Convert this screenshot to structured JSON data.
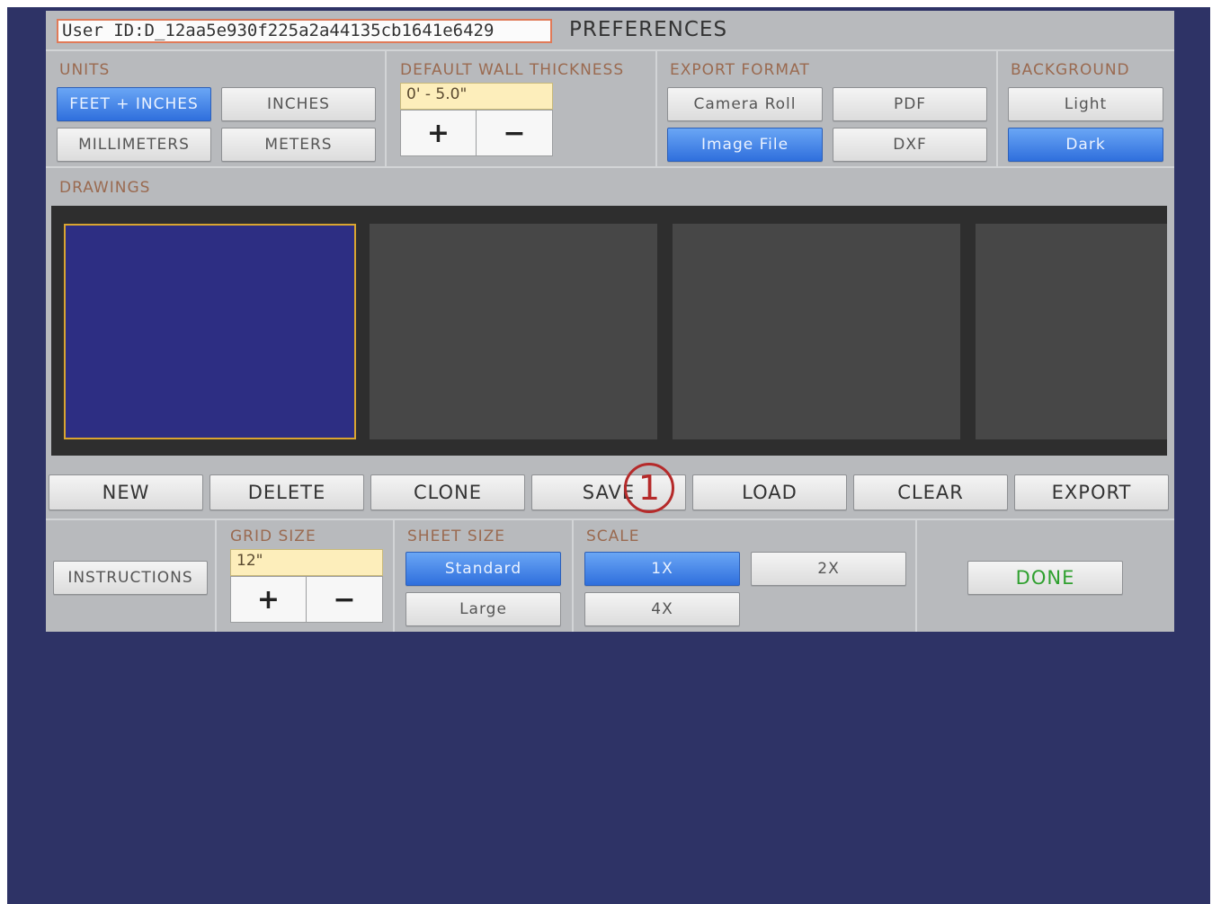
{
  "header": {
    "user_id": "User ID:D_12aa5e930f225a2a44135cb1641e6429",
    "title": "PREFERENCES"
  },
  "units": {
    "label": "UNITS",
    "options": [
      "FEET + INCHES",
      "INCHES",
      "MILLIMETERS",
      "METERS"
    ],
    "selected": "FEET + INCHES"
  },
  "wall_thickness": {
    "label": "DEFAULT WALL THICKNESS",
    "value": "0' - 5.0\"",
    "plus": "+",
    "minus": "−"
  },
  "export_format": {
    "label": "EXPORT FORMAT",
    "options": [
      "Camera Roll",
      "PDF",
      "Image File",
      "DXF"
    ],
    "selected": "Image File"
  },
  "background": {
    "label": "BACKGROUND",
    "options": [
      "Light",
      "Dark"
    ],
    "selected": "Dark"
  },
  "drawings": {
    "label": "DRAWINGS",
    "thumbnails": [
      "active",
      "empty",
      "empty",
      "empty"
    ]
  },
  "actions": [
    "NEW",
    "DELETE",
    "CLONE",
    "SAVE",
    "LOAD",
    "CLEAR",
    "EXPORT"
  ],
  "annotation": "1",
  "bottom": {
    "instructions": "INSTRUCTIONS",
    "grid_size": {
      "label": "GRID SIZE",
      "value": "12\"",
      "plus": "+",
      "minus": "−"
    },
    "sheet_size": {
      "label": "SHEET SIZE",
      "options": [
        "Standard",
        "Large"
      ],
      "selected": "Standard"
    },
    "scale": {
      "label": "SCALE",
      "options": [
        "1X",
        "2X",
        "4X"
      ],
      "selected": "1X"
    },
    "done": "DONE"
  },
  "colors": {
    "app_background": "#2e3366",
    "panel": "#b8babd",
    "selected_button": "#3b7be6",
    "section_label": "#9a6a50",
    "value_field": "#fdeebb",
    "active_thumbnail": "#2d2e83",
    "thumbnail_border": "#d9a530",
    "done_text": "#2fa02f",
    "annotation": "#b52a2a"
  }
}
